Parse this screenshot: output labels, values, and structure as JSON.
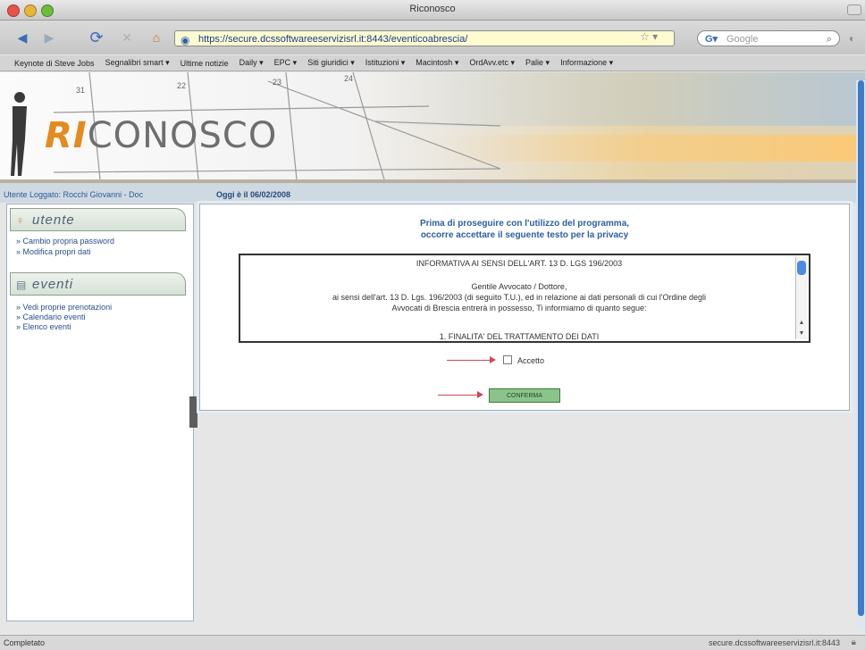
{
  "window": {
    "title": "Riconosco"
  },
  "browser": {
    "url": "https://secure.dcssoftwareeservizisrl.it:8443/eventicoabrescia/",
    "search_placeholder": "Google",
    "bookmarks": [
      "Keynote di Steve Jobs",
      "Segnalibri smart ▾",
      "Ultime notizie",
      "Daily ▾",
      "EPC ▾",
      "Siti giuridici ▾",
      "Istituzioni ▾",
      "Macintosh ▾",
      "OrdAvv.etc ▾",
      "Palie ▾",
      "Informazione ▾"
    ]
  },
  "banner": {
    "logo_ri": "RI",
    "logo_rest": "CONOSCO",
    "days": [
      "31",
      "22",
      "23",
      "24"
    ]
  },
  "userbar": {
    "logged": "Utente Loggato: Rocchi Giovanni - Doc",
    "today": "Oggi è il 06/02/2008"
  },
  "sidebar": {
    "utente": {
      "title": "utente",
      "items": [
        "» Cambio propria password",
        "» Modifica propri dati"
      ]
    },
    "eventi": {
      "title": "eventi",
      "items": [
        "» Vedi proprie prenotazioni",
        "» Calendario eventi",
        "» Elenco eventi"
      ]
    }
  },
  "main": {
    "intro_line1": "Prima di proseguire con l'utilizzo del programma,",
    "intro_line2": "occorre accettare il seguente testo per la privacy",
    "privacy_lines": [
      "INFORMATIVA AI SENSI DELL'ART. 13 D. LGS 196/2003",
      "Gentile Avvocato / Dottore,",
      "ai sensi dell'art. 13 D. Lgs. 196/2003 (di seguito T.U.), ed in relazione ai dati personali di cui l'Ordine degli",
      "Avvocati di Brescia entrerà in possesso, Ti informiamo di quanto segue:",
      "1. FINALITA' DEL TRATTAMENTO DEI DATI"
    ],
    "accept_label": "Accetto",
    "confirm_label": "CONFERMA"
  },
  "status": {
    "left": "Completato",
    "right": "secure.dcssoftwareeservizisrl.it:8443"
  },
  "colors": {
    "accent": "#2e5ea0",
    "arrow": "#c84a5b",
    "confirm": "#8bc48b"
  }
}
